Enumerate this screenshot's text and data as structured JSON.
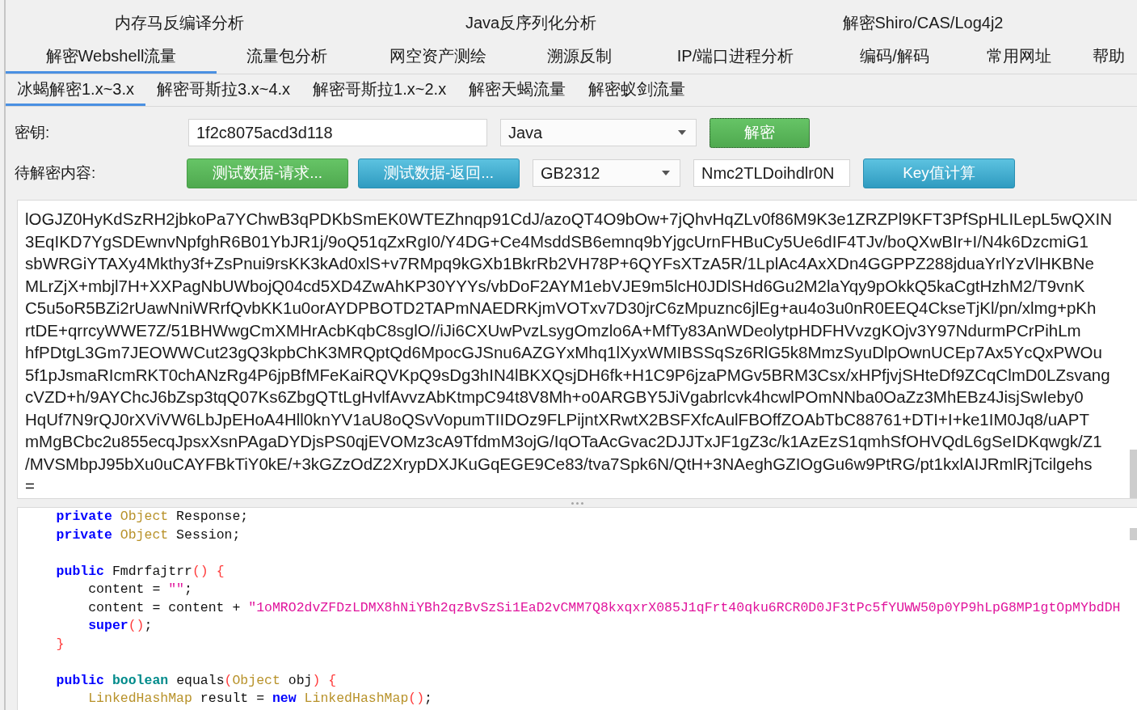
{
  "main_tab_rows": [
    {
      "tabs": [
        {
          "label": "内存马反编译分析",
          "selected": false
        },
        {
          "label": "Java反序列化分析",
          "selected": false
        },
        {
          "label": "解密Shiro/CAS/Log4j2",
          "selected": false
        }
      ]
    },
    {
      "tabs": [
        {
          "label": "解密Webshell流量",
          "selected": true
        },
        {
          "label": "流量包分析",
          "selected": false
        },
        {
          "label": "网空资产测绘",
          "selected": false
        },
        {
          "label": "溯源反制",
          "selected": false
        },
        {
          "label": "IP/端口进程分析",
          "selected": false
        },
        {
          "label": "编码/解码",
          "selected": false
        },
        {
          "label": "常用网址",
          "selected": false
        },
        {
          "label": "帮助",
          "selected": false
        }
      ]
    }
  ],
  "sub_tabs": [
    {
      "label": "冰蝎解密1.x~3.x",
      "selected": true
    },
    {
      "label": "解密哥斯拉3.x~4.x",
      "selected": false
    },
    {
      "label": "解密哥斯拉1.x~2.x",
      "selected": false
    },
    {
      "label": "解密天蝎流量",
      "selected": false
    },
    {
      "label": "解密蚁剑流量",
      "selected": false
    }
  ],
  "form_rows": [
    {
      "label": "密钥:",
      "controls": [
        {
          "kind": "input",
          "value": "1f2c8075acd3d118"
        },
        {
          "kind": "dropdown",
          "value": "Java"
        },
        {
          "kind": "success",
          "label": "解密",
          "focused": true
        }
      ]
    },
    {
      "label": "待解密内容:",
      "controls": [
        {
          "kind": "success",
          "label": "测试数据-请求...",
          "focused": false
        },
        {
          "kind": "info",
          "label": "测试数据-返回...",
          "focused": false
        },
        {
          "kind": "dropdown",
          "value": "GB2312"
        },
        {
          "kind": "input",
          "value": "Nmc2TLDoihdlr0N"
        },
        {
          "kind": "info",
          "label": "Key值计算",
          "focused": false
        }
      ]
    }
  ],
  "ciphertext": {
    "lines": [
      "lOGJZ0HyKdSzRH2jbkoPa7YChwB3qPDKbSmEK0WTEZhnqp91CdJ/azoQT4O9bOw+7jQhvHqZLv0f86M9K3e1ZRZPl9KFT3PfSpHLILepL5wQXIN",
      "3EqIKD7YgSDEwnvNpfghR6B01YbJR1j/9oQ51qZxRgI0/Y4DG+Ce4MsddSB6emnq9bYjgcUrnFHBuCy5Ue6dIF4TJv/boQXwBIr+I/N4k6DzcmiG1",
      "sbWRGiYTAXy4Mkthy3f+ZsPnui9rsKK3kAd0xlS+v7RMpq9kGXb1BkrRb2VH78P+6QYFsXTzA5R/1LplAc4AxXDn4GGPPZ288jduaYrlYzVlHKBNe",
      "MLrZjX+mbjl7H+XXPagNbUWbojQ04cd5XD4ZwAhKP30YYYs/vbDoF2AYM1ebVJE9m5lcH0JDlSHd6Gu2M2laYqy9pOkkQ5kaCgtHzhM2/T9vnK",
      "C5u5oR5BZi2rUawNniWRrfQvbKK1u0orAYDPBOTD2TAPmNAEDRKjmVOTxv7D30jrC6zMpuznc6jlEg+au4o3u0nR0EEQ4CkseTjKl/pn/xlmg+pKh",
      "rtDE+qrrcyWWE7Z/51BHWwgCmXMHrAcbKqbC8sglO//iJi6CXUwPvzLsygOmzlo6A+MfTy83AnWDeolytpHDFHVvzgKOjv3Y97NdurmPCrPihLm",
      "hfPDtgL3Gm7JEOWWCut23gQ3kpbChK3MRQptQd6MpocGJSnu6AZGYxMhq1lXyxWMIBSSqSz6RlG5k8MmzSyuDlpOwnUCEp7Ax5YcQxPWOu",
      "5f1pJsmaRIcmRKT0chANzRg4P6jpBfMFeKaiRQVKpQ9sDg3hIN4lBKXQsjDH6fk+H1C9P6jzaPMGv5BRM3Csx/xHPfjvjSHteDf9ZCqClmD0LZsvang",
      "cVZD+h/9AYChcJ6bZsp3tqQ07Ks6ZbgQTtLgHvlfAvvzAbKtmpC94t8V8Mh+o0ARGBY5JiVgabrlcvk4hcwlPOmNNba0OaZz3MhEBz4JisjSwIeby0",
      "HqUf7N9rQJ0rXViVW6LbJpEHoA4Hll0knYV1aU8oQSvVopumTIIDOz9FLPijntXRwtX2BSFXfcAulFBOffZOAbTbC88761+DTI+I+ke1IM0Jq8/uAPT",
      "mMgBCbc2u855ecqJpsxXsnPAgaDYDjsPS0qjEVOMz3cA9TfdmM3ojG/IqOTaAcGvac2DJJTxJF1gZ3c/k1AzEzS1qmhSfOHVQdL6gSeIDKqwgk/Z1",
      "/MVSMbpJ95bXu0uCAYFBkTiY0kE/+3kGZzOdZ2XrypDXJKuGqEGE9Ce83/tva7Spk6N/QtH+3NAeghGZIOgGu6w9PtRG/pt1kxlAIJRmlRjTcilgehs",
      "="
    ]
  },
  "code_editor": {
    "lines": [
      {
        "kind": "code",
        "tokens": [
          {
            "kind": "keyword",
            "text": "private"
          },
          {
            "kind": "type",
            "text": " Object"
          },
          {
            "kind": "plain",
            "text": " Response;"
          }
        ]
      },
      {
        "kind": "code",
        "tokens": [
          {
            "kind": "keyword",
            "text": "private"
          },
          {
            "kind": "type",
            "text": " Object"
          },
          {
            "kind": "plain",
            "text": " Session;"
          }
        ]
      },
      {
        "kind": "blank"
      },
      {
        "kind": "code",
        "tokens": [
          {
            "kind": "keyword",
            "text": "public"
          },
          {
            "kind": "plain",
            "text": " Fmdrfajtrr"
          },
          {
            "kind": "paren",
            "text": "() {"
          }
        ],
        "children": [
          {
            "kind": "code",
            "tokens": [
              {
                "kind": "plain",
                "text": "content = "
              },
              {
                "kind": "string",
                "text": "\"\""
              },
              {
                "kind": "plain",
                "text": ";"
              }
            ]
          },
          {
            "kind": "code",
            "tokens": [
              {
                "kind": "plain",
                "text": "content = content + "
              },
              {
                "kind": "string",
                "text": "\"1oMRO2dvZFDzLDMX8hNiYBh2qzBvSzSi1EaD2vCMM7Q8kxqxrX085J1qFrt40qku6RCR0D0JF3tPc5fYUWW50p0YP9hLpG8MP1gtOpMYbdDH"
              }
            ]
          },
          {
            "kind": "code",
            "tokens": [
              {
                "kind": "keyword",
                "text": "super"
              },
              {
                "kind": "paren",
                "text": "()"
              },
              {
                "kind": "plain",
                "text": ";"
              }
            ]
          }
        ]
      },
      {
        "kind": "code",
        "tokens": [
          {
            "kind": "paren",
            "text": "}"
          }
        ]
      },
      {
        "kind": "blank"
      },
      {
        "kind": "code",
        "tokens": [
          {
            "kind": "keyword",
            "text": "public"
          },
          {
            "kind": "primitive",
            "text": " boolean"
          },
          {
            "kind": "plain",
            "text": " equals"
          },
          {
            "kind": "paren",
            "text": "("
          },
          {
            "kind": "type",
            "text": "Object"
          },
          {
            "kind": "plain",
            "text": " obj"
          },
          {
            "kind": "paren",
            "text": ") {"
          }
        ],
        "children": [
          {
            "kind": "code",
            "tokens": [
              {
                "kind": "type",
                "text": "LinkedHashMap"
              },
              {
                "kind": "plain",
                "text": " result = "
              },
              {
                "kind": "keyword",
                "text": "new"
              },
              {
                "kind": "type",
                "text": " LinkedHashMap"
              },
              {
                "kind": "paren",
                "text": "()"
              },
              {
                "kind": "plain",
                "text": ";"
              }
            ]
          }
        ]
      }
    ]
  }
}
